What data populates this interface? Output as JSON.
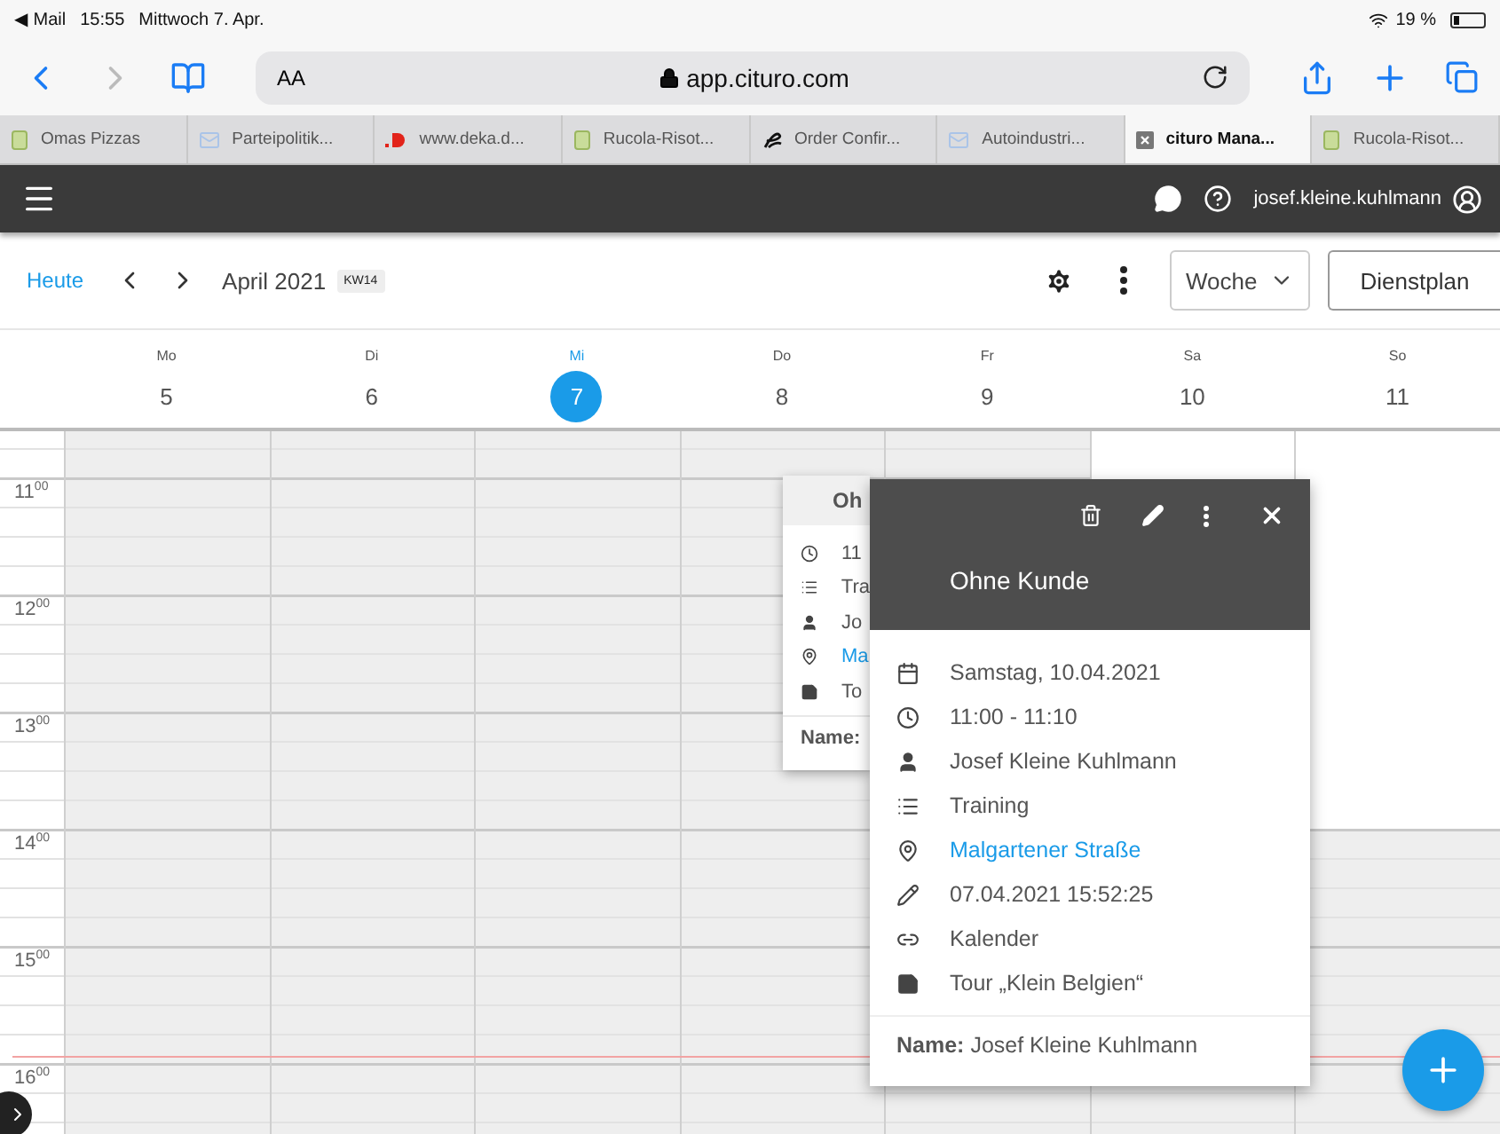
{
  "status_bar": {
    "back_app": "◀ Mail",
    "time": "15:55",
    "date": "Mittwoch 7. Apr.",
    "battery": "19 %"
  },
  "browser": {
    "text_size": "AA",
    "url": "app.cituro.com",
    "tabs": [
      {
        "title": "Omas Pizzas",
        "kind": "page",
        "selected": false
      },
      {
        "title": "Parteipolitik...",
        "kind": "mail",
        "selected": false
      },
      {
        "title": "www.deka.d...",
        "kind": "deka",
        "selected": false
      },
      {
        "title": "Rucola-Risot...",
        "kind": "page",
        "selected": false
      },
      {
        "title": "Order Confir...",
        "kind": "swirl",
        "selected": false
      },
      {
        "title": "Autoindustri...",
        "kind": "mail",
        "selected": false
      },
      {
        "title": "cituro Mana...",
        "kind": "closebox",
        "selected": true
      },
      {
        "title": "Rucola-Risot...",
        "kind": "page",
        "selected": false
      }
    ]
  },
  "app_header": {
    "user": "josef.kleine.kuhlmann"
  },
  "toolbar": {
    "today": "Heute",
    "period": "April 2021",
    "week": "KW14",
    "view": "Woche",
    "roster_button": "Dienstplan"
  },
  "days": [
    {
      "weekday": "Mo",
      "date": "5",
      "selected": false,
      "weekend": false
    },
    {
      "weekday": "Di",
      "date": "6",
      "selected": false,
      "weekend": false
    },
    {
      "weekday": "Mi",
      "date": "7",
      "selected": true,
      "weekend": false
    },
    {
      "weekday": "Do",
      "date": "8",
      "selected": false,
      "weekend": false
    },
    {
      "weekday": "Fr",
      "date": "9",
      "selected": false,
      "weekend": false
    },
    {
      "weekday": "Sa",
      "date": "10",
      "selected": false,
      "weekend": true
    },
    {
      "weekday": "So",
      "date": "11",
      "selected": false,
      "weekend": true
    }
  ],
  "hours": [
    "11$^{00}$",
    "12$^{00}$",
    "13$^{00}$",
    "14$^{00}$",
    "15$^{00}$",
    "16$^{00}$"
  ],
  "back_card": {
    "title": "Oh",
    "rows": [
      {
        "kind": "time",
        "text": "11"
      },
      {
        "kind": "category",
        "text": "Tra"
      },
      {
        "kind": "person",
        "text": "Jo"
      },
      {
        "kind": "location",
        "text": "Ma"
      },
      {
        "kind": "note",
        "text": "To"
      }
    ],
    "footer_label": "Name:"
  },
  "event_popup": {
    "title": "Ohne Kunde",
    "rows": [
      {
        "kind": "date",
        "text": "Samstag, 10.04.2021"
      },
      {
        "kind": "time",
        "text": "11:00 - 11:10"
      },
      {
        "kind": "person",
        "text": "Josef Kleine Kuhlmann"
      },
      {
        "kind": "category",
        "text": "Training"
      },
      {
        "kind": "location",
        "text": "Malgartener Straße"
      },
      {
        "kind": "edited",
        "text": "07.04.2021 15:52:25"
      },
      {
        "kind": "source",
        "text": "Kalender"
      },
      {
        "kind": "note",
        "text": "Tour „Klein Belgien“"
      }
    ],
    "footer_label": "Name:",
    "footer_value": "Josef Kleine Kuhlmann"
  }
}
